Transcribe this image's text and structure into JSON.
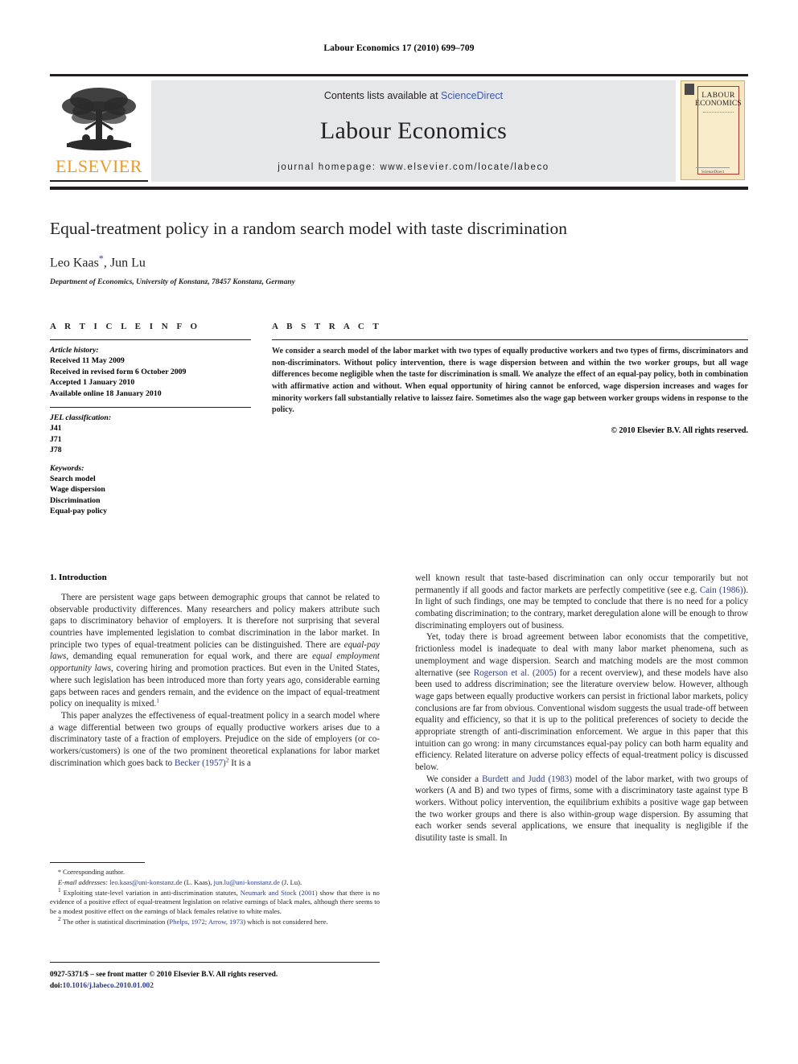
{
  "running_head": "Labour Economics 17 (2010) 699–709",
  "banner": {
    "publisher_wordmark": "ELSEVIER",
    "contents_prefix": "Contents lists available at ",
    "sciencedirect": "ScienceDirect",
    "journal_title": "Labour Economics",
    "homepage": "journal homepage: www.elsevier.com/locate/labeco",
    "cover": {
      "line1": "LABOUR",
      "line2": "ECONOMICS",
      "footer": "ScienceDirect"
    },
    "link_color": "#3b57b5",
    "elsevier_orange": "#E89A2C",
    "grey_panel": "#e6e7e8"
  },
  "article": {
    "title": "Equal-treatment policy in a random search model with taste discrimination",
    "authors": "Leo Kaas",
    "authors_rest": ", Jun Lu",
    "corresponding_mark": "*",
    "affiliation": "Department of Economics, University of Konstanz, 78457 Konstanz, Germany"
  },
  "info": {
    "heading": "A R T I C L E   I N F O",
    "history_label": "Article history:",
    "history": [
      "Received 11 May 2009",
      "Received in revised form 6 October 2009",
      "Accepted 1 January 2010",
      "Available online 18 January 2010"
    ],
    "jel_label": "JEL classification:",
    "jel": [
      "J41",
      "J71",
      "J78"
    ],
    "keywords_label": "Keywords:",
    "keywords": [
      "Search model",
      "Wage dispersion",
      "Discrimination",
      "Equal-pay policy"
    ]
  },
  "abstract": {
    "heading": "A B S T R A C T",
    "text": "We consider a search model of the labor market with two types of equally productive workers and two types of firms, discriminators and non-discriminators. Without policy intervention, there is wage dispersion between and within the two worker groups, but all wage differences become negligible when the taste for discrimination is small. We analyze the effect of an equal-pay policy, both in combination with affirmative action and without. When equal opportunity of hiring cannot be enforced, wage dispersion increases and wages for minority workers fall substantially relative to laissez faire. Sometimes also the wage gap between worker groups widens in response to the policy.",
    "copyright": "© 2010 Elsevier B.V. All rights reserved."
  },
  "body": {
    "section_title": "1. Introduction",
    "left_p1_a": "There are persistent wage gaps between demographic groups that cannot be related to observable productivity differences. Many researchers and policy makers attribute such gaps to discriminatory behavior of employers. It is therefore not surprising that several countries have implemented legislation to combat discrimination in the labor market. In principle two types of equal-treatment policies can be distinguished. There are ",
    "left_p1_it1": "equal-pay laws",
    "left_p1_b": ", demanding equal remuneration for equal work, and there are ",
    "left_p1_it2": "equal employment opportunity laws",
    "left_p1_c": ", covering hiring and promotion practices. But even in the United States, where such legislation has been introduced more than forty years ago, considerable earning gaps between races and genders remain, and the evidence on the impact of equal-treatment policy on inequality is mixed.",
    "left_p1_sup": "1",
    "left_p2_a": "This paper analyzes the effectiveness of equal-treatment policy in a search model where a wage differential between two groups of equally productive workers arises due to a discriminatory taste of a fraction of employers. Prejudice on the side of employers (or co-workers/customers) is one of the two prominent theoretical explanations for labor market discrimination which goes back to ",
    "left_p2_link": "Becker (1957)",
    "left_p2_sup": "2",
    "left_p2_b": " It is a",
    "right_p1_a": "well known result that taste-based discrimination can only occur temporarily but not permanently if all goods and factor markets are perfectly competitive (see e.g. ",
    "right_p1_link": "Cain (1986)",
    "right_p1_b": "). In light of such findings, one may be tempted to conclude that there is no need for a policy combating discrimination; to the contrary, market deregulation alone will be enough to throw discriminating employers out of business.",
    "right_p2_a": "Yet, today there is broad agreement between labor economists that the competitive, frictionless model is inadequate to deal with many labor market phenomena, such as unemployment and wage dispersion. Search and matching models are the most common alternative (see ",
    "right_p2_link": "Rogerson et al. (2005)",
    "right_p2_b": " for a recent overview), and these models have also been used to address discrimination; see the literature overview below. However, although wage gaps between equally productive workers can persist in frictional labor markets, policy conclusions are far from obvious. Conventional wisdom suggests the usual trade-off between equality and efficiency, so that it is up to the political preferences of society to decide the appropriate strength of anti-discrimination enforcement. We argue in this paper that this intuition can go wrong: in many circumstances equal-pay policy can both harm equality and efficiency. Related literature on adverse policy effects of equal-treatment policy is discussed below.",
    "right_p3_a": "We consider a ",
    "right_p3_link": "Burdett and Judd (1983)",
    "right_p3_b": " model of the labor market, with two groups of workers (A and B) and two types of firms, some with a discriminatory taste against type B workers. Without policy intervention, the equilibrium exhibits a positive wage gap between the two worker groups and there is also within-group wage dispersion. By assuming that each worker sends several applications, we ensure that inequality is negligible if the disutility taste is small. In"
  },
  "footnotes": {
    "corresponding": "Corresponding author.",
    "corresponding_mark": "*",
    "email_label": "E-mail addresses:",
    "email1": "leo.kaas@uni-konstanz.de",
    "email1_who": " (L. Kaas), ",
    "email2": "jun.lu@uni-konstanz.de",
    "email2_who": " (J. Lu).",
    "fn1_mark": "1",
    "fn1_a": "Exploiting state-level variation in anti-discrimination statutes, ",
    "fn1_link": "Neumark and Stock (2001)",
    "fn1_b": " show that there is no evidence of a positive effect of equal-treatment legislation on relative earnings of black males, although there seems to be a modest positive effect on the earnings of black females relative to white males.",
    "fn2_mark": "2",
    "fn2_a": "The other is statistical discrimination (",
    "fn2_link": "Phelps, 1972; Arrow, 1973",
    "fn2_b": ") which is not considered here."
  },
  "footer": {
    "front_matter": "0927-5371/$ – see front matter © 2010 Elsevier B.V. All rights reserved.",
    "doi_label": "doi:",
    "doi": "10.1016/j.labeco.2010.01.002"
  }
}
